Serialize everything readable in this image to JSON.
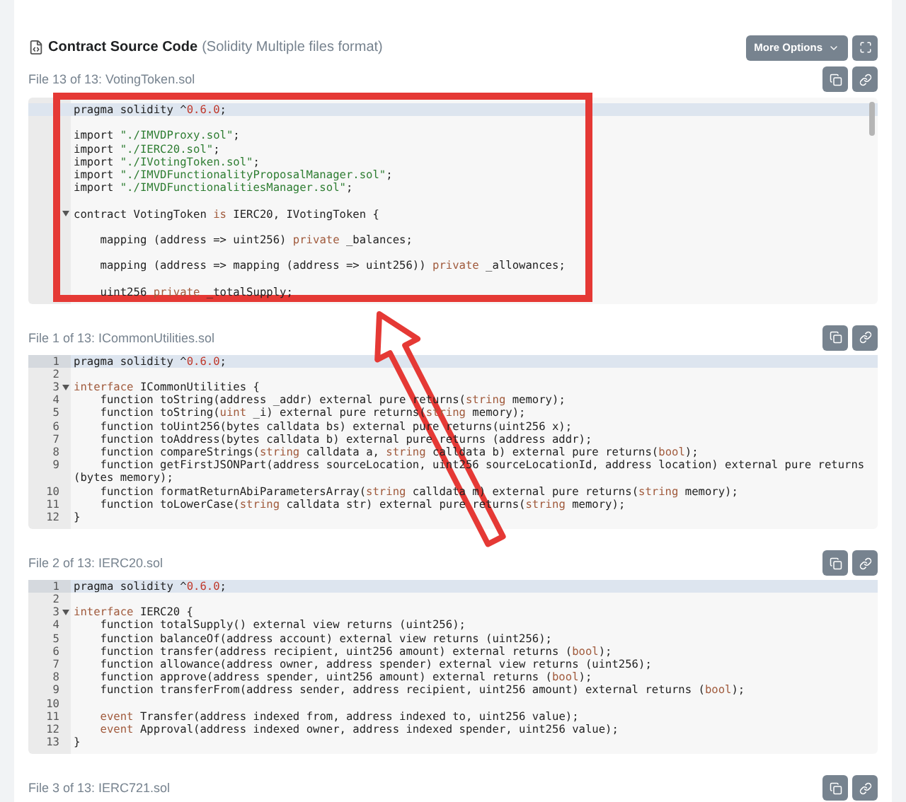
{
  "header": {
    "title": "Contract Source Code",
    "subtitle": "(Solidity Multiple files format)",
    "more_button": "More Options"
  },
  "files": [
    {
      "label": "File 13 of 13: VotingToken.sol",
      "scrollbar": true,
      "lines": [
        {
          "active": true,
          "fold": false,
          "segs": [
            {
              "text": "pragma solidity ^",
              "kind": "plain"
            },
            {
              "text": "0.6.0",
              "kind": "number"
            },
            {
              "text": ";",
              "kind": "plain"
            }
          ]
        },
        {
          "active": false,
          "fold": false
        },
        {
          "active": false,
          "fold": false,
          "segs": [
            {
              "text": "import ",
              "kind": "plain"
            },
            {
              "text": "\"./IMVDProxy.sol\"",
              "kind": "string"
            },
            {
              "text": ";",
              "kind": "plain"
            }
          ]
        },
        {
          "active": false,
          "fold": false,
          "segs": [
            {
              "text": "import ",
              "kind": "plain"
            },
            {
              "text": "\"./IERC20.sol\"",
              "kind": "string"
            },
            {
              "text": ";",
              "kind": "plain"
            }
          ]
        },
        {
          "active": false,
          "fold": false,
          "segs": [
            {
              "text": "import ",
              "kind": "plain"
            },
            {
              "text": "\"./IVotingToken.sol\"",
              "kind": "string"
            },
            {
              "text": ";",
              "kind": "plain"
            }
          ]
        },
        {
          "active": false,
          "fold": false,
          "segs": [
            {
              "text": "import ",
              "kind": "plain"
            },
            {
              "text": "\"./IMVDFunctionalityProposalManager.sol\"",
              "kind": "string"
            },
            {
              "text": ";",
              "kind": "plain"
            }
          ]
        },
        {
          "active": false,
          "fold": false,
          "segs": [
            {
              "text": "import ",
              "kind": "plain"
            },
            {
              "text": "\"./IMVDFunctionalitiesManager.sol\"",
              "kind": "string"
            },
            {
              "text": ";",
              "kind": "plain"
            }
          ]
        },
        {
          "active": false,
          "fold": false
        },
        {
          "active": false,
          "fold": true,
          "segs": [
            {
              "text": "contract VotingToken ",
              "kind": "plain"
            },
            {
              "text": "is",
              "kind": "keyword"
            },
            {
              "text": " IERC20, IVotingToken {",
              "kind": "plain"
            }
          ]
        },
        {
          "active": false,
          "fold": false
        },
        {
          "active": false,
          "fold": false,
          "segs": [
            {
              "text": "    mapping (address => uint256) ",
              "kind": "plain"
            },
            {
              "text": "private",
              "kind": "keyword"
            },
            {
              "text": " _balances;",
              "kind": "plain"
            }
          ]
        },
        {
          "active": false,
          "fold": false
        },
        {
          "active": false,
          "fold": false,
          "segs": [
            {
              "text": "    mapping (address => mapping (address => uint256)) ",
              "kind": "plain"
            },
            {
              "text": "private",
              "kind": "keyword"
            },
            {
              "text": " _allowances;",
              "kind": "plain"
            }
          ]
        },
        {
          "active": false,
          "fold": false
        },
        {
          "active": false,
          "fold": false,
          "segs": [
            {
              "text": "    uint256 ",
              "kind": "plain"
            },
            {
              "text": "private",
              "kind": "keyword"
            },
            {
              "text": " _totalSupply;",
              "kind": "plain"
            }
          ]
        }
      ]
    },
    {
      "label": "File 1 of 13: ICommonUtilities.sol",
      "lines": [
        {
          "n": "1",
          "active": true,
          "fold": false,
          "segs": [
            {
              "text": "pragma solidity ^",
              "kind": "plain"
            },
            {
              "text": "0.6.0",
              "kind": "number"
            },
            {
              "text": ";",
              "kind": "plain"
            }
          ]
        },
        {
          "n": "2",
          "active": false,
          "fold": false
        },
        {
          "n": "3",
          "active": false,
          "fold": true,
          "segs": [
            {
              "text": "interface",
              "kind": "keyword"
            },
            {
              "text": " ICommonUtilities {",
              "kind": "plain"
            }
          ]
        },
        {
          "n": "4",
          "active": false,
          "fold": false,
          "segs": [
            {
              "text": "    function toString(address _addr) external pure returns(",
              "kind": "plain"
            },
            {
              "text": "string",
              "kind": "keyword"
            },
            {
              "text": " memory);",
              "kind": "plain"
            }
          ]
        },
        {
          "n": "5",
          "active": false,
          "fold": false,
          "segs": [
            {
              "text": "    function toString(",
              "kind": "plain"
            },
            {
              "text": "uint",
              "kind": "keyword"
            },
            {
              "text": " _i) external pure returns(",
              "kind": "plain"
            },
            {
              "text": "string",
              "kind": "keyword"
            },
            {
              "text": " memory);",
              "kind": "plain"
            }
          ]
        },
        {
          "n": "6",
          "active": false,
          "fold": false,
          "segs": [
            {
              "text": "    function toUint256(bytes calldata bs) external pure returns(uint256 x);",
              "kind": "plain"
            }
          ]
        },
        {
          "n": "7",
          "active": false,
          "fold": false,
          "segs": [
            {
              "text": "    function toAddress(bytes calldata b) external pure returns (address addr);",
              "kind": "plain"
            }
          ]
        },
        {
          "n": "8",
          "active": false,
          "fold": false,
          "segs": [
            {
              "text": "    function compareStrings(",
              "kind": "plain"
            },
            {
              "text": "string",
              "kind": "keyword"
            },
            {
              "text": " calldata a, ",
              "kind": "plain"
            },
            {
              "text": "string",
              "kind": "keyword"
            },
            {
              "text": " calldata b) external pure returns(",
              "kind": "plain"
            },
            {
              "text": "bool",
              "kind": "keyword"
            },
            {
              "text": ");",
              "kind": "plain"
            }
          ]
        },
        {
          "n": "9",
          "active": false,
          "fold": false,
          "segs": [
            {
              "text": "    function getFirstJSONPart(address sourceLocation, uint256 sourceLocationId, address location) external pure returns (bytes memory);",
              "kind": "plain"
            }
          ]
        },
        {
          "n": "10",
          "active": false,
          "fold": false,
          "segs": [
            {
              "text": "    function formatReturnAbiParametersArray(",
              "kind": "plain"
            },
            {
              "text": "string",
              "kind": "keyword"
            },
            {
              "text": " calldata m) external pure returns(",
              "kind": "plain"
            },
            {
              "text": "string",
              "kind": "keyword"
            },
            {
              "text": " memory);",
              "kind": "plain"
            }
          ]
        },
        {
          "n": "11",
          "active": false,
          "fold": false,
          "segs": [
            {
              "text": "    function toLowerCase(",
              "kind": "plain"
            },
            {
              "text": "string",
              "kind": "keyword"
            },
            {
              "text": " calldata str) external pure returns(",
              "kind": "plain"
            },
            {
              "text": "string",
              "kind": "keyword"
            },
            {
              "text": " memory);",
              "kind": "plain"
            }
          ]
        },
        {
          "n": "12",
          "active": false,
          "fold": false,
          "segs": [
            {
              "text": "}",
              "kind": "plain"
            }
          ]
        }
      ]
    },
    {
      "label": "File 2 of 13: IERC20.sol",
      "lines": [
        {
          "n": "1",
          "active": true,
          "fold": false,
          "segs": [
            {
              "text": "pragma solidity ^",
              "kind": "plain"
            },
            {
              "text": "0.6.0",
              "kind": "number"
            },
            {
              "text": ";",
              "kind": "plain"
            }
          ]
        },
        {
          "n": "2",
          "active": false,
          "fold": false
        },
        {
          "n": "3",
          "active": false,
          "fold": true,
          "segs": [
            {
              "text": "interface",
              "kind": "keyword"
            },
            {
              "text": " IERC20 {",
              "kind": "plain"
            }
          ]
        },
        {
          "n": "4",
          "active": false,
          "fold": false,
          "segs": [
            {
              "text": "    function totalSupply() external view returns (uint256);",
              "kind": "plain"
            }
          ]
        },
        {
          "n": "5",
          "active": false,
          "fold": false,
          "segs": [
            {
              "text": "    function balanceOf(address account) external view returns (uint256);",
              "kind": "plain"
            }
          ]
        },
        {
          "n": "6",
          "active": false,
          "fold": false,
          "segs": [
            {
              "text": "    function transfer(address recipient, uint256 amount) external returns (",
              "kind": "plain"
            },
            {
              "text": "bool",
              "kind": "keyword"
            },
            {
              "text": ");",
              "kind": "plain"
            }
          ]
        },
        {
          "n": "7",
          "active": false,
          "fold": false,
          "segs": [
            {
              "text": "    function allowance(address owner, address spender) external view returns (uint256);",
              "kind": "plain"
            }
          ]
        },
        {
          "n": "8",
          "active": false,
          "fold": false,
          "segs": [
            {
              "text": "    function approve(address spender, uint256 amount) external returns (",
              "kind": "plain"
            },
            {
              "text": "bool",
              "kind": "keyword"
            },
            {
              "text": ");",
              "kind": "plain"
            }
          ]
        },
        {
          "n": "9",
          "active": false,
          "fold": false,
          "segs": [
            {
              "text": "    function transferFrom(address sender, address recipient, uint256 amount) external returns (",
              "kind": "plain"
            },
            {
              "text": "bool",
              "kind": "keyword"
            },
            {
              "text": ");",
              "kind": "plain"
            }
          ]
        },
        {
          "n": "10",
          "active": false,
          "fold": false
        },
        {
          "n": "11",
          "active": false,
          "fold": false,
          "segs": [
            {
              "text": "    event",
              "kind": "keyword"
            },
            {
              "text": " Transfer(address indexed from, address indexed to, uint256 value);",
              "kind": "plain"
            }
          ]
        },
        {
          "n": "12",
          "active": false,
          "fold": false,
          "segs": [
            {
              "text": "    event",
              "kind": "keyword"
            },
            {
              "text": " Approval(address indexed owner, address indexed spender, uint256 value);",
              "kind": "plain"
            }
          ]
        },
        {
          "n": "13",
          "active": false,
          "fold": false,
          "segs": [
            {
              "text": "}",
              "kind": "plain"
            }
          ]
        }
      ]
    },
    {
      "label": "File 3 of 13: IERC721.sol"
    }
  ]
}
